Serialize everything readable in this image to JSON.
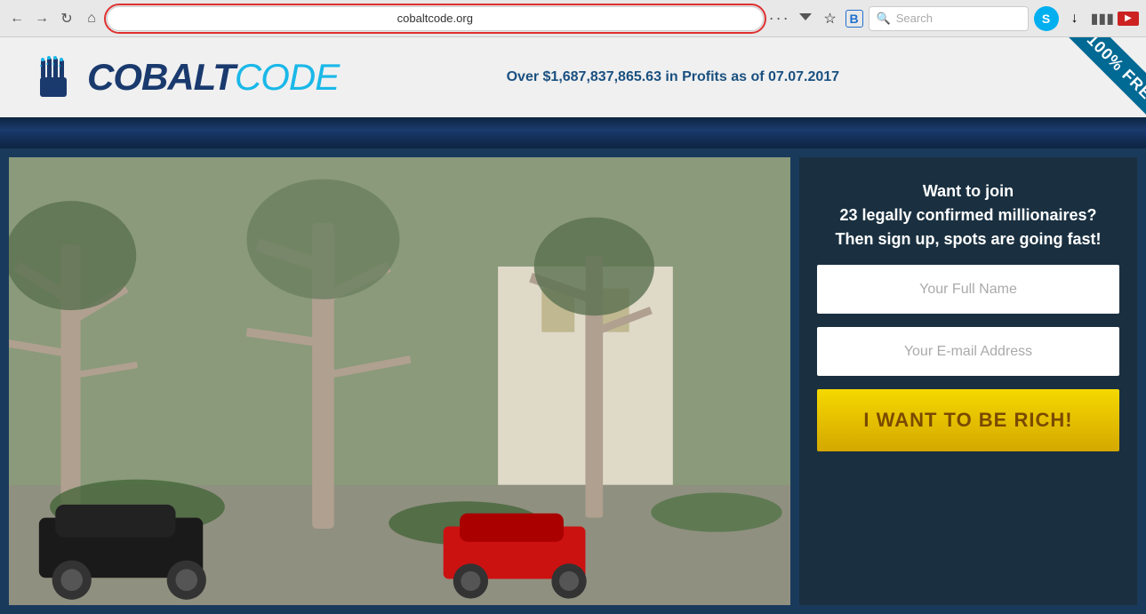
{
  "browser": {
    "url": "cobaltcode.org",
    "search_placeholder": "Search",
    "nav": {
      "back_label": "←",
      "forward_label": "→",
      "home_label": "🏠",
      "refresh_label": "↺",
      "dots_label": "···"
    }
  },
  "header": {
    "logo_cobalt": "COBALT",
    "logo_code": "CODE",
    "tagline": "Over $1,687,837,865.63 in Profits as of 07.07.2017",
    "ribbon_text": "100% FRE"
  },
  "signup": {
    "title_line1": "Want to join",
    "title_line2": "23 legally confirmed millionaires?",
    "title_line3": "Then sign up, spots are going fast!",
    "name_placeholder": "Your Full Name",
    "email_placeholder": "Your E-mail Address",
    "cta_label": "I WANT TO BE RICH!"
  }
}
